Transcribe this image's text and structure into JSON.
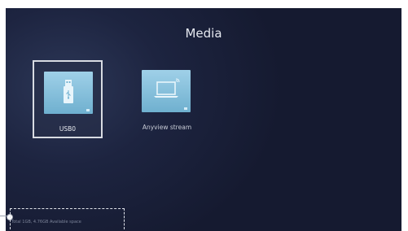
{
  "screen": {
    "title": "Media"
  },
  "sources": [
    {
      "label": "USB0",
      "icon": "usb-drive-icon",
      "selected": true
    },
    {
      "label": "Anyview stream",
      "icon": "laptop-cast-icon",
      "selected": false
    }
  ],
  "colors": {
    "background": "#1d2440",
    "tile_thumb": "#8cc4de",
    "selection_border": "#d8dbe2"
  },
  "footer": {
    "hint": "Total 1GB, 4.76GB Available space"
  }
}
